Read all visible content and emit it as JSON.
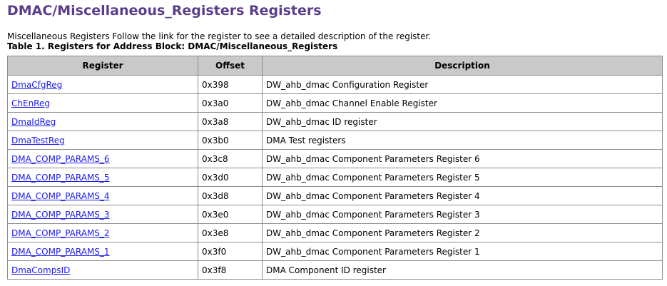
{
  "page": {
    "title": "DMAC/Miscellaneous_Registers Registers",
    "intro": "Miscellaneous Registers Follow the link for the register to see a detailed description of the register.",
    "table_caption": "Table 1. Registers for Address Block: DMAC/Miscellaneous_Registers"
  },
  "colors": {
    "title": "#5a3d8a",
    "link": "#1a1aee",
    "header_bg": "#c9c9c9"
  },
  "table": {
    "headers": [
      "Register",
      "Offset",
      "Description"
    ],
    "rows": [
      {
        "register": "DmaCfgReg",
        "offset": "0x398",
        "description": "DW_ahb_dmac Configuration Register"
      },
      {
        "register": "ChEnReg",
        "offset": "0x3a0",
        "description": "DW_ahb_dmac Channel Enable Register"
      },
      {
        "register": "DmaIdReg",
        "offset": "0x3a8",
        "description": "DW_ahb_dmac ID register"
      },
      {
        "register": "DmaTestReg",
        "offset": "0x3b0",
        "description": "DMA Test registers"
      },
      {
        "register": "DMA_COMP_PARAMS_6",
        "offset": "0x3c8",
        "description": "DW_ahb_dmac Component Parameters Register 6"
      },
      {
        "register": "DMA_COMP_PARAMS_5",
        "offset": "0x3d0",
        "description": "DW_ahb_dmac Component Parameters Register 5"
      },
      {
        "register": "DMA_COMP_PARAMS_4",
        "offset": "0x3d8",
        "description": "DW_ahb_dmac Component Parameters Register 4"
      },
      {
        "register": "DMA_COMP_PARAMS_3",
        "offset": "0x3e0",
        "description": "DW_ahb_dmac Component Parameters Register 3"
      },
      {
        "register": "DMA_COMP_PARAMS_2",
        "offset": "0x3e8",
        "description": "DW_ahb_dmac Component Parameters Register 2"
      },
      {
        "register": "DMA_COMP_PARAMS_1",
        "offset": "0x3f0",
        "description": "DW_ahb_dmac Component Parameters Register 1"
      },
      {
        "register": "DmaCompsID",
        "offset": "0x3f8",
        "description": "DMA Component ID register"
      }
    ]
  }
}
